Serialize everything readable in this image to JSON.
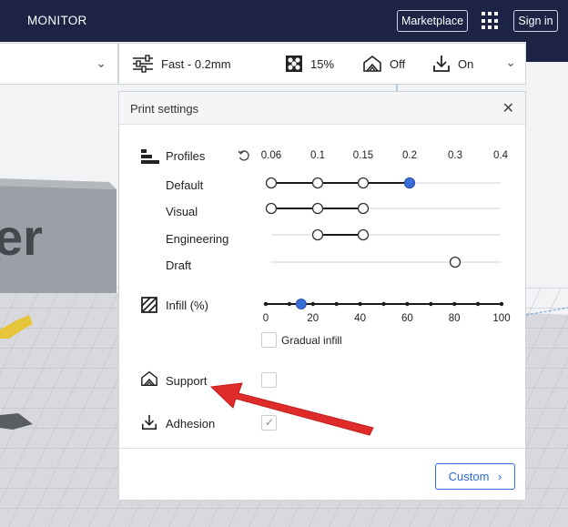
{
  "topbar": {
    "tab_label": "MONITOR",
    "marketplace_label": "Marketplace",
    "signin_label": "Sign in"
  },
  "summary": {
    "profile_label": "Fast - 0.2mm",
    "infill_label": "15%",
    "support_label": "Off",
    "adhesion_label": "On"
  },
  "panel": {
    "title": "Print settings",
    "profiles": {
      "label": "Profiles",
      "ticks": [
        "0.06",
        "0.1",
        "0.15",
        "0.2",
        "0.3",
        "0.4"
      ],
      "rows": [
        {
          "name": "Default",
          "points": [
            0.06,
            0.1,
            0.15,
            0.2
          ],
          "selected": 0.2
        },
        {
          "name": "Visual",
          "points": [
            0.06,
            0.1,
            0.15
          ],
          "selected": null
        },
        {
          "name": "Engineering",
          "points": [
            0.1,
            0.15
          ],
          "selected": null
        },
        {
          "name": "Draft",
          "points": [
            0.3
          ],
          "selected": null
        }
      ]
    },
    "infill": {
      "label": "Infill (%)",
      "ticks": [
        "0",
        "20",
        "40",
        "60",
        "80",
        "100"
      ],
      "value": 15,
      "gradual_label": "Gradual infill",
      "gradual_checked": false
    },
    "support": {
      "label": "Support",
      "checked": false
    },
    "adhesion": {
      "label": "Adhesion",
      "checked": true
    },
    "custom_label": "Custom"
  },
  "viewport": {
    "model_text": "er"
  },
  "colors": {
    "navy": "#1c2344",
    "accent_blue": "#2b6bdc",
    "selected_dot": "#3b6fd8",
    "arrow_red": "#e02b2b"
  }
}
